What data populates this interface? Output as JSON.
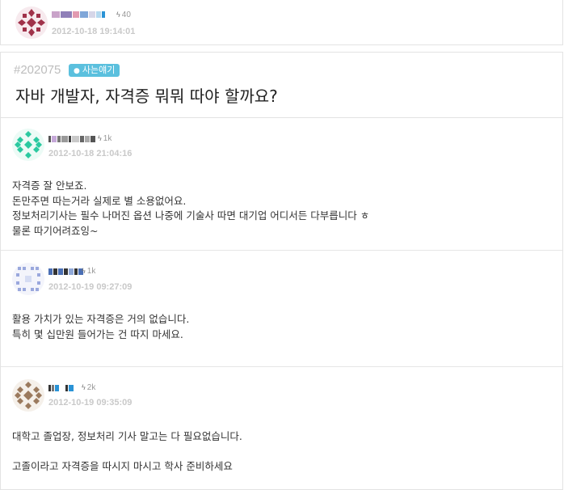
{
  "question": {
    "author": {
      "score": "40",
      "date": "2012-10-18 19:14:01"
    },
    "id": "#202075",
    "category": "사는얘기",
    "title": "자바 개발자, 자격증 뭐뭐 따야 할까요?"
  },
  "answers": [
    {
      "nickname": "ku..ulluu..",
      "score": "1k",
      "date": "2012-10-18 21:04:16",
      "content": "자격증 잘 안보죠.\n돈만주면 따는거라 실제로 별 소용없어요.\n정보처리기사는 필수 나머진 옵션 나중에 기술사 따면 대기업 어디서든 다부릅니다 ㅎ\n물론 따기어려죠잉~"
    },
    {
      "nickname": "cpnlgl",
      "score": "1k",
      "date": "2012-10-19 09:27:09",
      "content": "활용 가치가 있는 자격증은 거의 없습니다.\n특히 몇 십만원 들어가는 건 따지 마세요."
    },
    {
      "nickname": "",
      "score": "2k",
      "date": "2012-10-19 09:35:09",
      "content": "대학고 졸업장, 정보처리 기사 말고는 다 필요없습니다.\n\n고졸이라고 자격증을 따시지 마시고 학사 준비하세요"
    }
  ],
  "colors": {
    "tag_bg": "#5bc0de",
    "date": "#c9c9c9",
    "avatar_q": "#a0324a",
    "avatar_a1": "#2bc9a0",
    "avatar_a2": "#9aa8dd",
    "avatar_a3": "#9b7a5e"
  },
  "icons": [
    "bolt-icon",
    "comment-icon"
  ]
}
